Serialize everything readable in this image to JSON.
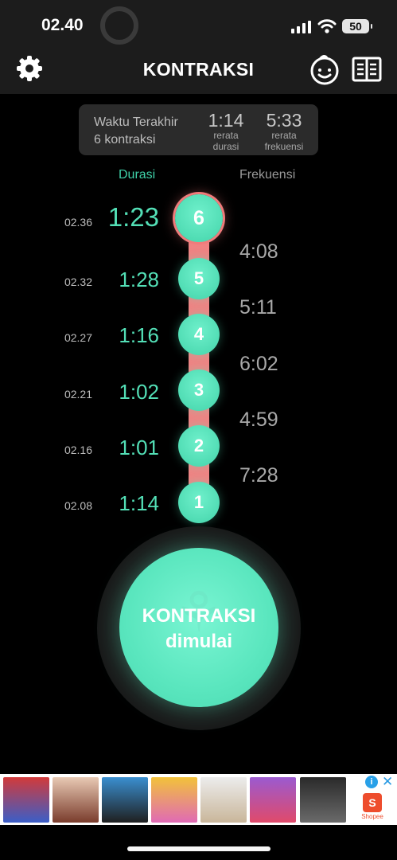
{
  "status_bar": {
    "time": "02.40",
    "battery": "50"
  },
  "header": {
    "title": "KONTRAKSI",
    "icons": [
      "gear-icon",
      "baby-face-icon",
      "book-icon"
    ]
  },
  "summary": {
    "last_label": "Waktu Terakhir",
    "last_count": "6 kontraksi",
    "avg_duration": {
      "value": "1:14",
      "label_1": "rerata",
      "label_2": "durasi"
    },
    "avg_frequency": {
      "value": "5:33",
      "label_1": "rerata",
      "label_2": "frekuensi"
    }
  },
  "columns": {
    "duration": "Durasi",
    "frequency": "Frekuensi"
  },
  "contractions": [
    {
      "number": "6",
      "time": "02.36",
      "duration": "1:23"
    },
    {
      "number": "5",
      "time": "02.32",
      "duration": "1:28"
    },
    {
      "number": "4",
      "time": "02.27",
      "duration": "1:16"
    },
    {
      "number": "3",
      "time": "02.21",
      "duration": "1:02"
    },
    {
      "number": "2",
      "time": "02.16",
      "duration": "1:01"
    },
    {
      "number": "1",
      "time": "02.08",
      "duration": "1:14"
    }
  ],
  "frequencies": [
    "4:08",
    "5:11",
    "6:02",
    "4:59",
    "7:28"
  ],
  "main_button": {
    "line1": "KONTRAKSI",
    "line2": "dimulai"
  },
  "ad": {
    "label": "Shopee",
    "colors": {
      "accent": "#53dfb6",
      "alert": "#f08484"
    }
  }
}
